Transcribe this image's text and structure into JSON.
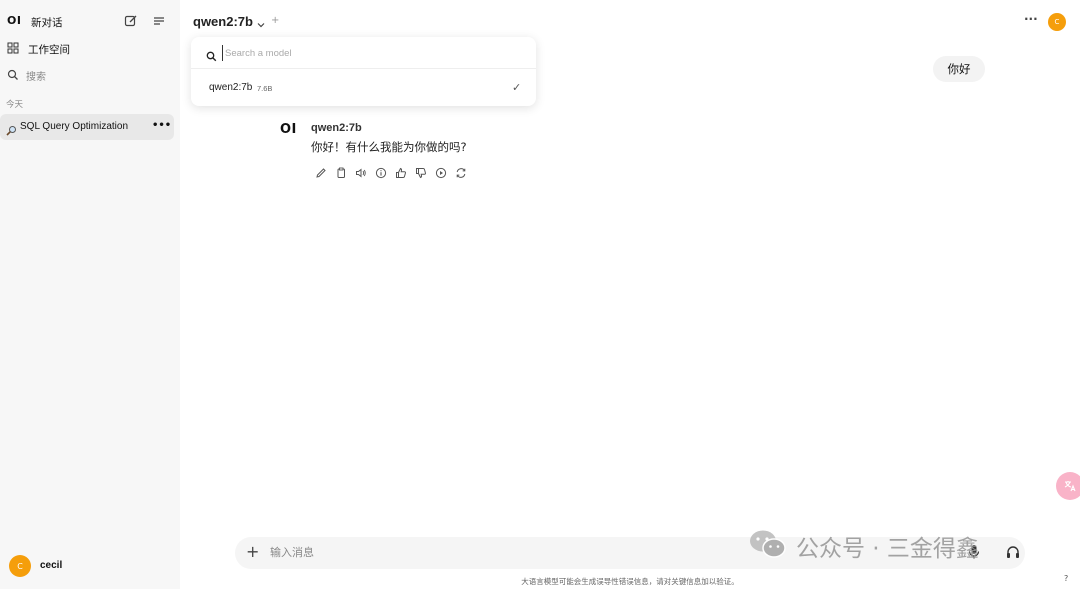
{
  "sidebar": {
    "logo": "OI",
    "new_chat_label": "新对话",
    "workspace_label": "工作空间",
    "search_label": "搜索",
    "section_today": "今天",
    "chats": [
      {
        "label": "SQL Query Optimization",
        "more": "•••"
      }
    ],
    "user": {
      "avatar_letter": "C",
      "name": "cecil"
    }
  },
  "header": {
    "model_name": "qwen2:7b",
    "add_symbol": "+",
    "more": "···",
    "avatar_letter": "C"
  },
  "model_dropdown": {
    "search_placeholder": "Search a model",
    "items": [
      {
        "name": "qwen2:7b",
        "size": "7.6B",
        "selected": true
      }
    ],
    "check": "✓"
  },
  "conversation": {
    "user_message": "你好",
    "assistant": {
      "logo": "OI",
      "name": "qwen2:7b",
      "text": "你好！有什么我能为你做的吗?",
      "actions": [
        "edit-icon",
        "copy-icon",
        "speaker-icon",
        "info-icon",
        "thumbs-up-icon",
        "thumbs-down-icon",
        "continue-icon",
        "regenerate-icon"
      ]
    }
  },
  "composer": {
    "plus": "+",
    "placeholder": "输入消息",
    "disclaimer": "大语言模型可能会生成误导性错误信息，请对关键信息加以验证。",
    "help": "?"
  },
  "watermark": {
    "text": "公众号 · 三金得鑫"
  },
  "colors": {
    "sidebar_bg": "#f7f7f7",
    "avatar": "#f59e0b",
    "active_chat": "#e8e8e8"
  }
}
